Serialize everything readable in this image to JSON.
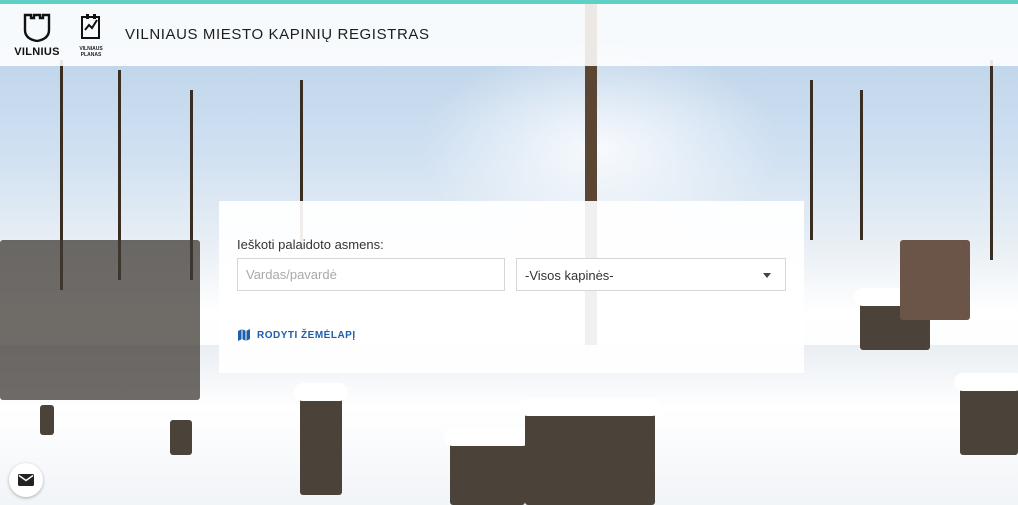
{
  "header": {
    "logo_text": "VILNIUS",
    "planas_text": "VILNIAUS PLANAS",
    "title": "VILNIAUS MIESTO KAPINIŲ REGISTRAS"
  },
  "search": {
    "label": "Ieškoti palaidoto asmens:",
    "name_placeholder": "Vardas/pavardė",
    "cemetery_selected": "-Visos kapinės-",
    "map_link": "RODYTI ŽEMĖLAPĮ"
  },
  "colors": {
    "accent_bar": "#5fd0c6",
    "link": "#1f5ea8"
  },
  "icons": [
    "vilnius-shield-icon",
    "vilnius-planas-icon",
    "map-icon",
    "mail-icon",
    "chevron-down-icon"
  ]
}
